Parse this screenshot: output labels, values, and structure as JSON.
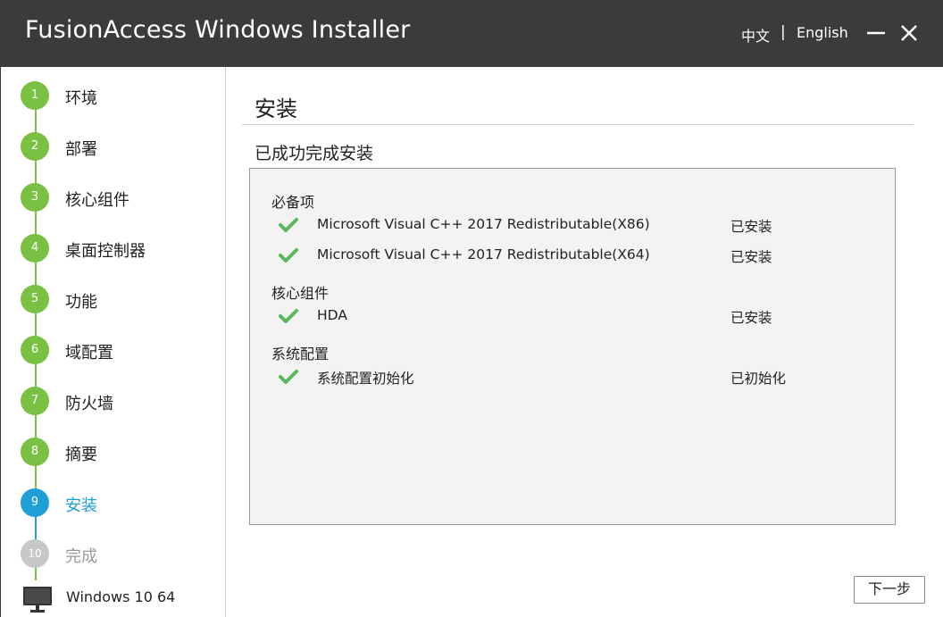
{
  "window": {
    "title": "FusionAccess Windows Installer",
    "lang_zh": "中文",
    "lang_separator": "|",
    "lang_en": "English"
  },
  "sidebar": {
    "steps": [
      {
        "number": "1",
        "label": "环境",
        "state": "done"
      },
      {
        "number": "2",
        "label": "部署",
        "state": "done"
      },
      {
        "number": "3",
        "label": "核心组件",
        "state": "done"
      },
      {
        "number": "4",
        "label": "桌面控制器",
        "state": "done"
      },
      {
        "number": "5",
        "label": "功能",
        "state": "done"
      },
      {
        "number": "6",
        "label": "域配置",
        "state": "done"
      },
      {
        "number": "7",
        "label": "防火墙",
        "state": "done"
      },
      {
        "number": "8",
        "label": "摘要",
        "state": "done"
      },
      {
        "number": "9",
        "label": "安装",
        "state": "active"
      },
      {
        "number": "10",
        "label": "完成",
        "state": "pending"
      }
    ],
    "os_label": "Windows 10 64"
  },
  "main": {
    "page_title": "安装",
    "status_text": "已成功完成安装",
    "groups": [
      {
        "title": "必备项",
        "items": [
          {
            "name": "Microsoft Visual C++ 2017 Redistributable(X86)",
            "status": "已安装"
          },
          {
            "name": "Microsoft Visual C++ 2017 Redistributable(X64)",
            "status": "已安装"
          }
        ]
      },
      {
        "title": "核心组件",
        "items": [
          {
            "name": "HDA",
            "status": "已安装"
          }
        ]
      },
      {
        "title": "系统配置",
        "items": [
          {
            "name": "系统配置初始化",
            "status": "已初始化"
          }
        ]
      }
    ],
    "next_button": "下一步"
  },
  "colors": {
    "titlebar": "#3b3b3b",
    "step_done": "#7ac143",
    "step_active": "#1e9fd8",
    "step_pending": "#c8c8c8",
    "check": "#5cb85c"
  },
  "icons": {
    "check": "check-icon",
    "minimize": "minimize-icon",
    "close": "close-icon",
    "monitor": "monitor-icon"
  }
}
